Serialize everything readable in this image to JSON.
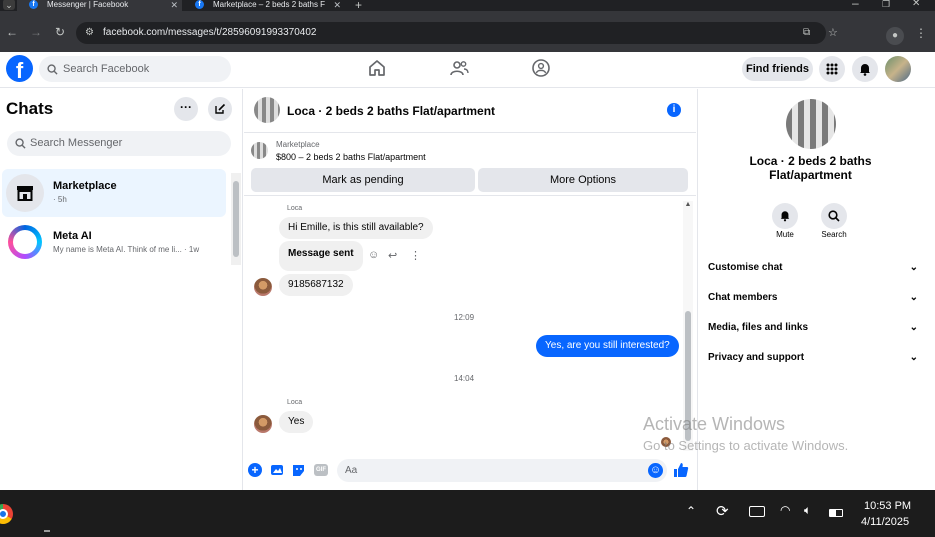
{
  "browser": {
    "tabs": [
      {
        "title": "Messenger | Facebook",
        "active": true
      },
      {
        "title": "Marketplace – 2 beds 2 baths F",
        "active": false
      }
    ],
    "url": "facebook.com/messages/t/28596091993370402"
  },
  "header": {
    "search_placeholder": "Search Facebook",
    "find_friends": "Find friends"
  },
  "sidebar": {
    "title": "Chats",
    "search_placeholder": "Search Messenger",
    "chats": [
      {
        "name": "Marketplace",
        "preview": "· 5h"
      },
      {
        "name": "Meta AI",
        "preview": "My name is Meta AI. Think of me li... · 1w"
      }
    ]
  },
  "conversation": {
    "title": "Loca · 2 beds 2 baths Flat/apartment",
    "marketplace_label": "Marketplace",
    "listing": "$800 – 2 beds 2 baths Flat/apartment",
    "mark_pending": "Mark as pending",
    "more_options": "More Options",
    "messages": [
      {
        "sender": "Loca",
        "text": "Hi Emille, is this still available?"
      },
      {
        "text": "Message sent"
      },
      {
        "text": "9185687132"
      },
      {
        "time": "12:09"
      },
      {
        "text": "Yes, are you still interested?"
      },
      {
        "time": "14:04"
      },
      {
        "sender": "Loca",
        "text": "Yes"
      }
    ],
    "composer_placeholder": "Aa",
    "accent": "#0866ff"
  },
  "details": {
    "title": "Loca · 2 beds 2 baths Flat/apartment",
    "mute": "Mute",
    "search": "Search",
    "menu": [
      "Customise chat",
      "Chat members",
      "Media, files and links",
      "Privacy and support"
    ]
  },
  "watermark": {
    "line1": "Activate Windows",
    "line2": "Go to Settings to activate Windows."
  },
  "taskbar": {
    "time": "10:53 PM",
    "date": "4/11/2025"
  }
}
